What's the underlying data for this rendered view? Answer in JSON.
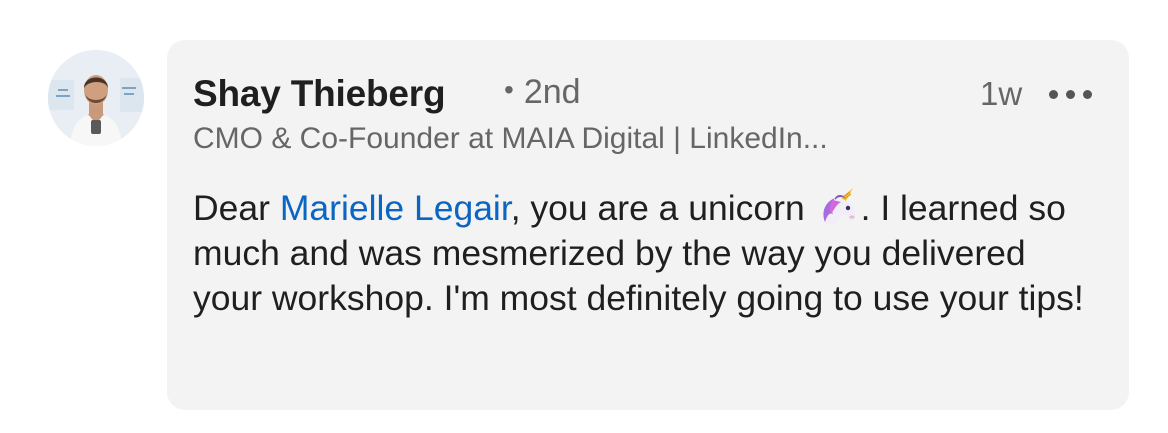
{
  "comment": {
    "author": {
      "name": "Shay Thieberg",
      "degree": "2nd",
      "degree_separator": "•",
      "headline": "CMO & Co-Founder at MAIA Digital | LinkedIn...",
      "avatar_icon": "profile-photo"
    },
    "timestamp": "1w",
    "more_icon": "more-options-ellipsis",
    "body": {
      "prefix": "Dear ",
      "mention": "Marielle Legair",
      "part_after_mention": ", you are a unicorn ",
      "emoji_icon": "unicorn-emoji",
      "part_after_emoji": ". I learned so much and was mesmerized by the way you delivered your workshop. I'm most definitely going to use your tips!"
    }
  },
  "colors": {
    "bubble_bg": "#f3f3f3",
    "mention_link": "#0a66c2",
    "primary_text": "#1f1f1f",
    "secondary_text": "#666666"
  }
}
